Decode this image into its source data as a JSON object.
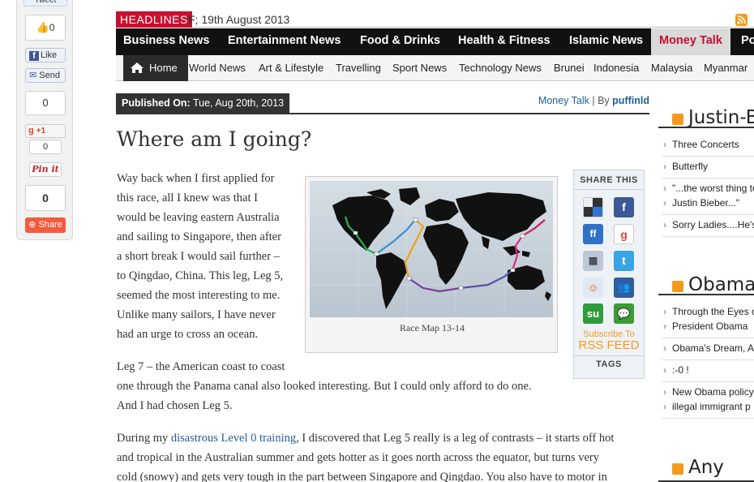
{
  "share_float": {
    "tweet_label": "Tweet",
    "like_count": "0",
    "fb_like_label": "Like",
    "fb_send_label": "Send",
    "count_1": "0",
    "gplus_label": "+1",
    "gplus_count": "0",
    "pinit_label": "Pin it",
    "share_count": "0",
    "share_label": "Share"
  },
  "headlines": {
    "label": "HEADLINES",
    "text": "F; 19th August 2013"
  },
  "main_nav": [
    {
      "label": "Business News",
      "active": false
    },
    {
      "label": "Entertainment News",
      "active": false
    },
    {
      "label": "Food & Drinks",
      "active": false
    },
    {
      "label": "Health & Fitness",
      "active": false
    },
    {
      "label": "Islamic News",
      "active": false
    },
    {
      "label": "Money Talk",
      "active": true
    },
    {
      "label": "Po",
      "active": false
    }
  ],
  "sub_nav": {
    "home": "Home",
    "items": [
      "World News",
      "Art & Lifestyle",
      "Travelling",
      "Sport News",
      "Technology News",
      "Brunei",
      "Indonesia",
      "Malaysia",
      "Myanmar"
    ]
  },
  "post_meta": {
    "published_label": "Published On:",
    "date": "Tue, Aug 20th, 2013",
    "category": "Money Talk",
    "separator": " | By ",
    "author": "puffinld"
  },
  "article": {
    "title": "Where am I going?",
    "p1_lines": [
      "Way back when I first applied for",
      "this race, all I knew was that I",
      "would be leaving eastern Australia",
      "and sailing to Singapore, then after",
      "a short break I would sail further –",
      "to Qingdao, China. This leg, Leg 5,",
      "seemed the most interesting to me.",
      "Unlike many sailors, I have never",
      "had an urge to cross an ocean."
    ],
    "p2_lines": [
      "Leg 7 – the American coast to coast",
      "one through the Panama canal also looked interesting. But I could only afford to do one.",
      "And I had chosen Leg 5."
    ],
    "p3_prefix": "During my ",
    "p3_link": "disastrous Level 0 training",
    "p3_suffix": ", I discovered that Leg 5 really is a leg of contrasts – it starts off hot",
    "p3_lines": [
      "and tropical in the Australian summer and gets hotter as it goes north across the equator, but turns very",
      "cold (snowy) and gets very tough in the part between Singapore and Qingdao. You also have to motor in"
    ],
    "figure_caption": "Race Map 13-14"
  },
  "share_this": {
    "title": "SHARE THIS",
    "icons": [
      "delicious-icon",
      "facebook-icon",
      "friendfeed-icon",
      "google-icon",
      "digg-icon",
      "twitter-icon",
      "reddit-icon",
      "myspace-icon",
      "stumbleupon-icon",
      "technorati-icon"
    ],
    "subscribe_line": "Subscribe To",
    "rss_line": "RSS FEED",
    "tags_label": "TAGS"
  },
  "sidebar": {
    "sections": [
      {
        "title": "Justin-B",
        "items": [
          "Three Concerts",
          "Butterfly",
          "\"...the worst thing to",
          "Justin Bieber...\"",
          "Sorry Ladies....He's"
        ]
      },
      {
        "title": "Obama",
        "items": [
          "Through the Eyes o",
          "President Obama",
          "Obama's Dream, A",
          ":-0 !",
          "New Obama policy",
          "illegal immigrant p"
        ]
      },
      {
        "title": "Any",
        "items": []
      }
    ]
  },
  "colors": {
    "brand_red": "#c8102e",
    "nav_black": "#111111",
    "link_blue": "#1f5f99",
    "rss_orange": "#f39a1e"
  }
}
